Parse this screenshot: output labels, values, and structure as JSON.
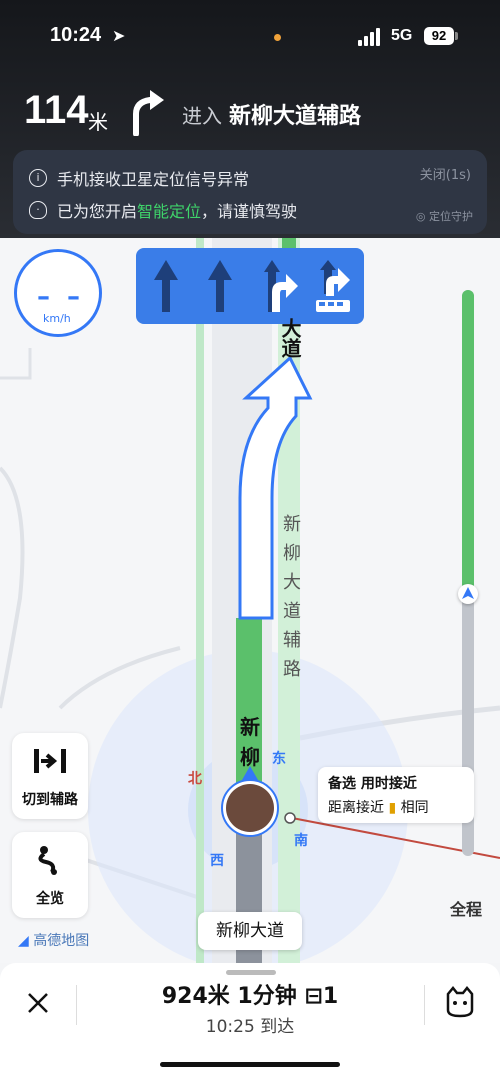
{
  "status": {
    "time": "10:24",
    "network": "5G",
    "battery": "92"
  },
  "nav": {
    "distance": "114",
    "unit": "米",
    "action": "进入",
    "road": "新柳大道辅路"
  },
  "alert": {
    "line1": "手机接收卫星定位信号异常",
    "line2_prefix": "已为您开启",
    "line2_highlight": "智能定位",
    "line2_suffix": "，请谨慎驾驶",
    "close": "关闭(1s)",
    "guard": "定位守护"
  },
  "speed": {
    "value": "– –",
    "unit": "km/h"
  },
  "lanes": [
    "straight-arrow-icon",
    "straight-arrow-icon",
    "right-turn-arrow-icon",
    "bus-lane-right-icon"
  ],
  "buttons": {
    "aux": "切到辅路",
    "overview": "全览"
  },
  "progress": {
    "label": "全程",
    "fraction": 0.53
  },
  "callout": {
    "line1": "备选 用时接近",
    "line2_prefix": "距离接近",
    "line2_suffix": "相同"
  },
  "map": {
    "compass": {
      "north": "北",
      "east": "东",
      "south": "南",
      "west": "西"
    },
    "road_top": "大道",
    "side_road_chars": [
      "新",
      "柳",
      "大",
      "道",
      "辅",
      "路"
    ],
    "main_road_chars": [
      "新",
      "柳"
    ],
    "road_label": "新柳大道",
    "brand": "高德地图"
  },
  "bottom": {
    "eta": "924米 1分钟",
    "lights": "1",
    "arrive": "10:25 到达"
  },
  "colors": {
    "route": "#5bc06b",
    "lane_panel": "#3a7de8",
    "accent": "#3478f6",
    "banner": "#2f3644"
  }
}
